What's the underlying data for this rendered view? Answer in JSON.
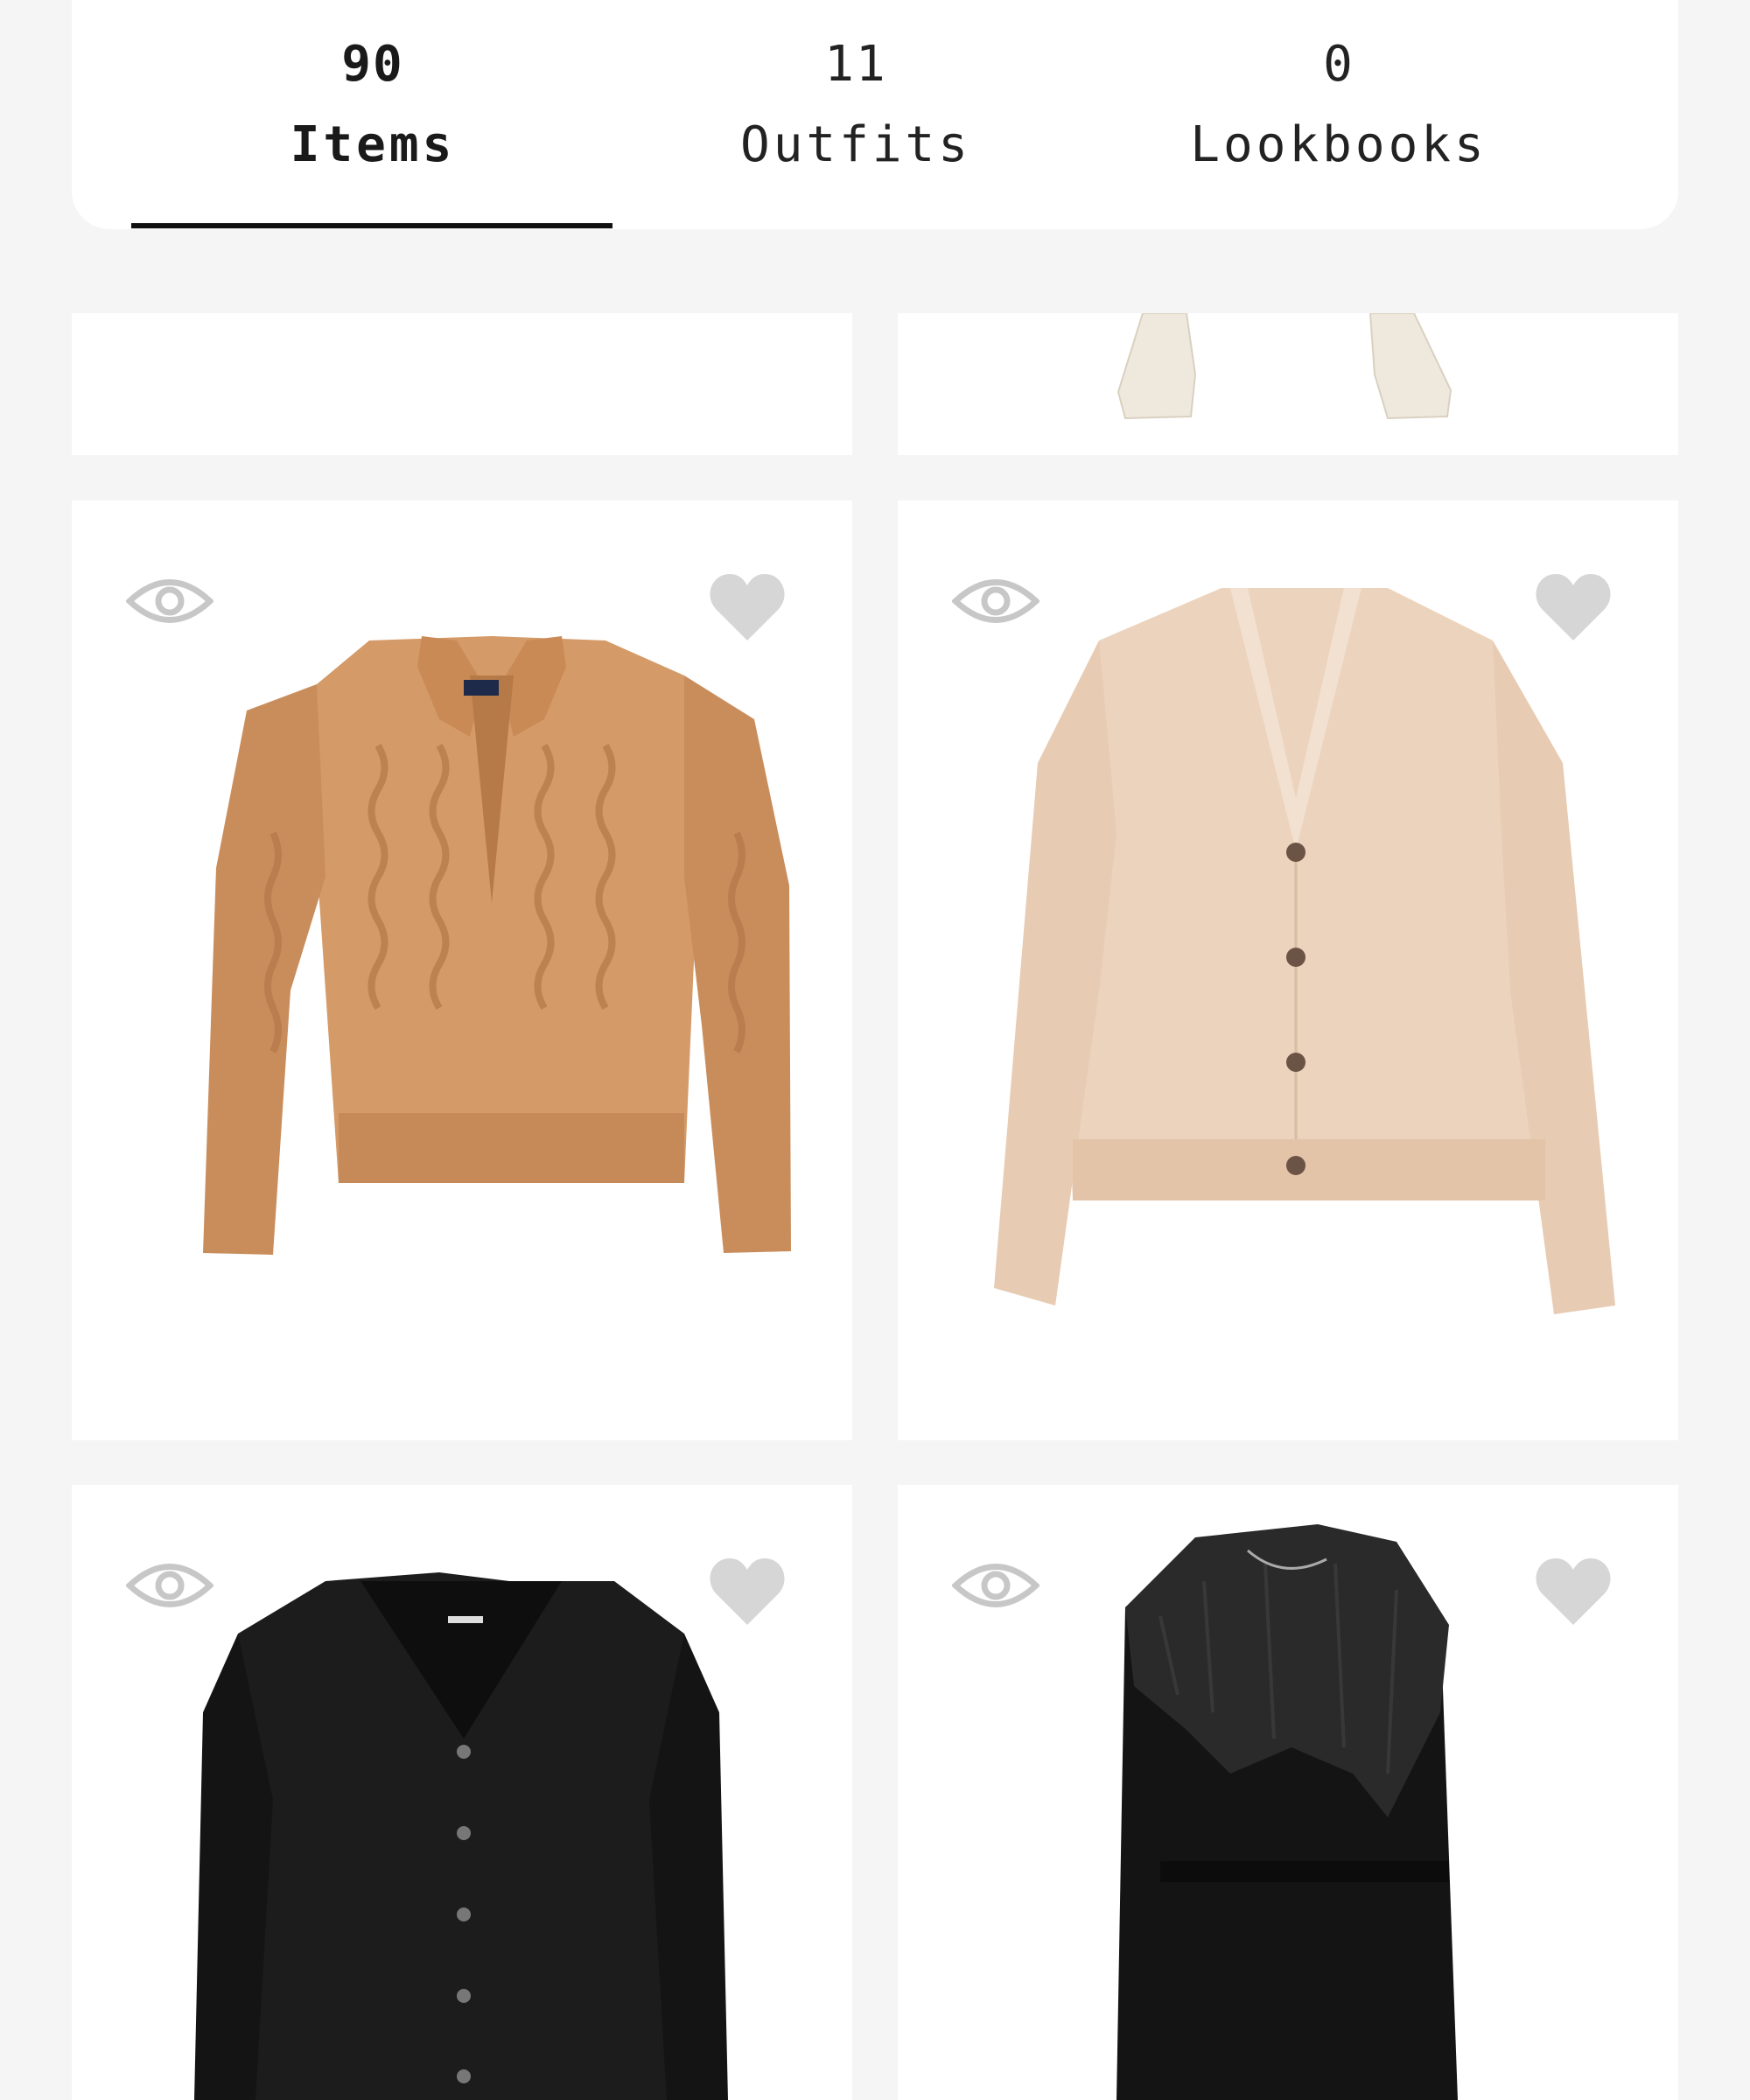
{
  "tabs": [
    {
      "count": "90",
      "label": "Items",
      "active": true
    },
    {
      "count": "11",
      "label": "Outfits",
      "active": false
    },
    {
      "count": "0",
      "label": "Lookbooks",
      "active": false
    }
  ],
  "items": [
    {
      "name": "ivory-trousers",
      "color": "#efe9dd"
    },
    {
      "name": "camel-cable-knit-sweater",
      "color": "#d49a68"
    },
    {
      "name": "beige-fuzzy-cardigan",
      "color": "#ecd3bd"
    },
    {
      "name": "black-ribbed-cardigan",
      "color": "#1c1c1c"
    },
    {
      "name": "black-fur-collar-coat",
      "color": "#141414"
    }
  ]
}
